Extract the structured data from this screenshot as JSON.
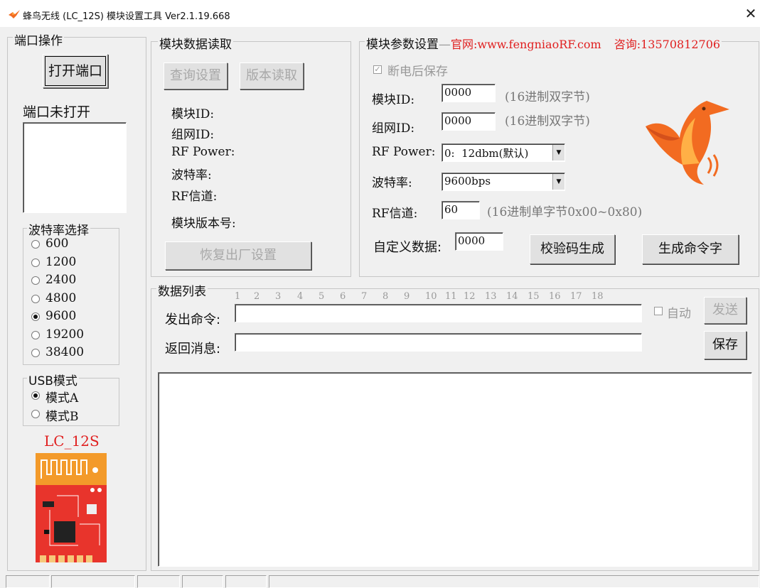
{
  "window": {
    "title": "蜂鸟无线 (LC_12S) 模块设置工具 Ver2.1.19.668",
    "close_symbol": "✕"
  },
  "port_group": {
    "legend": "端口操作",
    "open_button": "打开端口",
    "status": "端口未打开"
  },
  "baud_group": {
    "legend": "波特率选择",
    "options": [
      "600",
      "1200",
      "2400",
      "4800",
      "9600",
      "19200",
      "38400"
    ],
    "selected": "9600"
  },
  "usb_group": {
    "legend": "USB模式",
    "options": [
      "模式A",
      "模式B"
    ],
    "selected": "模式A"
  },
  "module_image": {
    "label": "LC_12S"
  },
  "read_group": {
    "legend": "模块数据读取",
    "query_button": "查询设置",
    "version_button": "版本读取",
    "fields": {
      "module_id": "模块ID:",
      "network_id": "组网ID:",
      "rf_power": "RF Power:",
      "baud": "波特率:",
      "rf_channel": "RF信道:",
      "version": "模块版本号:"
    },
    "restore_button": "恢复出厂设置"
  },
  "param_group": {
    "legend": "模块参数设置",
    "website": "官网:www.fengniaoRF.com",
    "contact": "咨询:13570812706",
    "save_on_power_off": "断电后保存",
    "module_id_label": "模块ID:",
    "module_id_value": "0000",
    "module_id_hint": "(16进制双字节)",
    "network_id_label": "组网ID:",
    "network_id_value": "0000",
    "network_id_hint": "(16进制双字节)",
    "rf_power_label": "RF Power:",
    "rf_power_value": "0:  12dbm(默认)",
    "baud_label": "波特率:",
    "baud_value": "9600bps",
    "rf_channel_label": "RF信道:",
    "rf_channel_value": "60",
    "rf_channel_hint": "(16进制单字节0x00~0x80)",
    "custom_data_label": "自定义数据:",
    "custom_data_value": "0000",
    "checksum_button": "校验码生成",
    "generate_button": "生成命令字"
  },
  "data_group": {
    "legend": "数据列表",
    "ruler": [
      "1",
      "2",
      "3",
      "4",
      "5",
      "6",
      "7",
      "8",
      "9",
      "10",
      "11",
      "12",
      "13",
      "14",
      "15",
      "16",
      "17",
      "18"
    ],
    "send_cmd_label": "发出命令:",
    "send_cmd_value": "",
    "return_msg_label": "返回消息:",
    "return_msg_value": "",
    "auto_label": "自动",
    "send_button": "发送",
    "save_button": "保存"
  },
  "icons": {
    "app": "hummingbird-icon",
    "logo": "hummingbird-logo",
    "dropdown": "chevron-down-icon"
  },
  "colors": {
    "accent_red": "#e02020",
    "bird_orange": "#f26b21",
    "pcb_red": "#e8342c"
  }
}
